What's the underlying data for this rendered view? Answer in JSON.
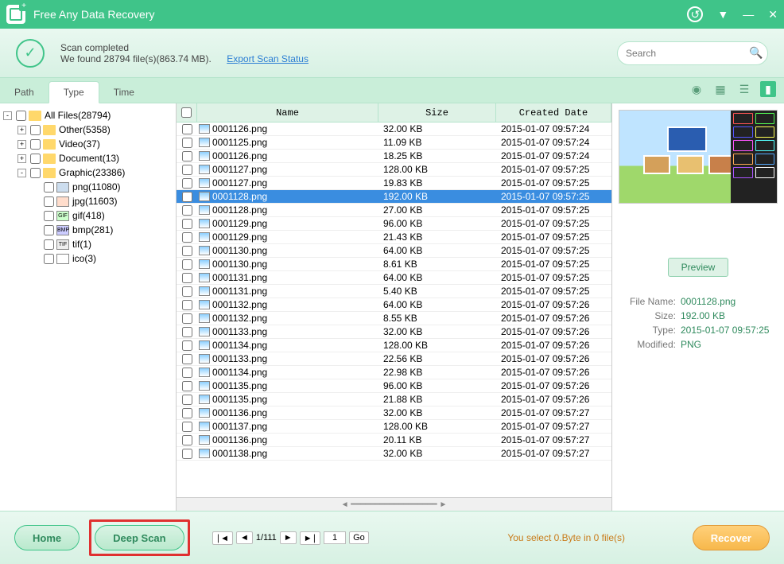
{
  "app": {
    "title": "Free Any Data Recovery"
  },
  "status": {
    "line1": "Scan completed",
    "line2": "We found 28794 file(s)(863.74 MB).",
    "export_link": "Export Scan Status",
    "search_placeholder": "Search"
  },
  "tabs": {
    "path": "Path",
    "type": "Type",
    "time": "Time"
  },
  "tree": {
    "root": "All Files(28794)",
    "other": "Other(5358)",
    "video": "Video(37)",
    "document": "Document(13)",
    "graphic": "Graphic(23386)",
    "png": "png(11080)",
    "jpg": "jpg(11603)",
    "gif": "gif(418)",
    "bmp": "bmp(281)",
    "tif": "tif(1)",
    "ico": "ico(3)"
  },
  "columns": {
    "name": "Name",
    "size": "Size",
    "date": "Created Date"
  },
  "files": [
    {
      "name": "0001126.png",
      "size": "32.00 KB",
      "date": "2015-01-07 09:57:24"
    },
    {
      "name": "0001125.png",
      "size": "11.09 KB",
      "date": "2015-01-07 09:57:24"
    },
    {
      "name": "0001126.png",
      "size": "18.25 KB",
      "date": "2015-01-07 09:57:24"
    },
    {
      "name": "0001127.png",
      "size": "128.00 KB",
      "date": "2015-01-07 09:57:25"
    },
    {
      "name": "0001127.png",
      "size": "19.83 KB",
      "date": "2015-01-07 09:57:25"
    },
    {
      "name": "0001128.png",
      "size": "192.00 KB",
      "date": "2015-01-07 09:57:25",
      "selected": true
    },
    {
      "name": "0001128.png",
      "size": "27.00 KB",
      "date": "2015-01-07 09:57:25"
    },
    {
      "name": "0001129.png",
      "size": "96.00 KB",
      "date": "2015-01-07 09:57:25"
    },
    {
      "name": "0001129.png",
      "size": "21.43 KB",
      "date": "2015-01-07 09:57:25"
    },
    {
      "name": "0001130.png",
      "size": "64.00 KB",
      "date": "2015-01-07 09:57:25"
    },
    {
      "name": "0001130.png",
      "size": "8.61 KB",
      "date": "2015-01-07 09:57:25"
    },
    {
      "name": "0001131.png",
      "size": "64.00 KB",
      "date": "2015-01-07 09:57:25"
    },
    {
      "name": "0001131.png",
      "size": "5.40 KB",
      "date": "2015-01-07 09:57:25"
    },
    {
      "name": "0001132.png",
      "size": "64.00 KB",
      "date": "2015-01-07 09:57:26"
    },
    {
      "name": "0001132.png",
      "size": "8.55 KB",
      "date": "2015-01-07 09:57:26"
    },
    {
      "name": "0001133.png",
      "size": "32.00 KB",
      "date": "2015-01-07 09:57:26"
    },
    {
      "name": "0001134.png",
      "size": "128.00 KB",
      "date": "2015-01-07 09:57:26"
    },
    {
      "name": "0001133.png",
      "size": "22.56 KB",
      "date": "2015-01-07 09:57:26"
    },
    {
      "name": "0001134.png",
      "size": "22.98 KB",
      "date": "2015-01-07 09:57:26"
    },
    {
      "name": "0001135.png",
      "size": "96.00 KB",
      "date": "2015-01-07 09:57:26"
    },
    {
      "name": "0001135.png",
      "size": "21.88 KB",
      "date": "2015-01-07 09:57:26"
    },
    {
      "name": "0001136.png",
      "size": "32.00 KB",
      "date": "2015-01-07 09:57:27"
    },
    {
      "name": "0001137.png",
      "size": "128.00 KB",
      "date": "2015-01-07 09:57:27"
    },
    {
      "name": "0001136.png",
      "size": "20.11 KB",
      "date": "2015-01-07 09:57:27"
    },
    {
      "name": "0001138.png",
      "size": "32.00 KB",
      "date": "2015-01-07 09:57:27"
    }
  ],
  "preview": {
    "button": "Preview",
    "filename_label": "File Name:",
    "filename": "0001128.png",
    "size_label": "Size:",
    "size": "192.00 KB",
    "type_label": "Type:",
    "type": "2015-01-07 09:57:25",
    "modified_label": "Modified:",
    "modified": "PNG"
  },
  "pager": {
    "pages": "1/111",
    "current": "1",
    "go": "Go"
  },
  "bottom": {
    "home": "Home",
    "deep_scan": "Deep Scan",
    "recover": "Recover",
    "selection": "You select 0.Byte in 0 file(s)"
  }
}
